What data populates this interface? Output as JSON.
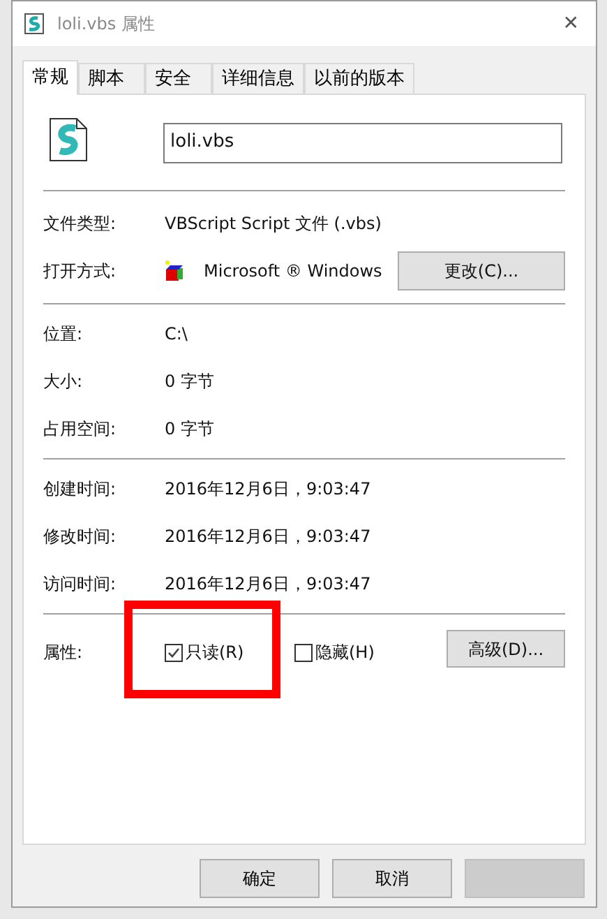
{
  "window": {
    "title": "loli.vbs 属性",
    "close": "✕"
  },
  "tabs": [
    {
      "label": "常规",
      "selected": true
    },
    {
      "label": "脚本",
      "selected": false
    },
    {
      "label": "安全",
      "selected": false
    },
    {
      "label": "详细信息",
      "selected": false
    },
    {
      "label": "以前的版本",
      "selected": false
    }
  ],
  "file_name": "loli.vbs",
  "type_info": [
    {
      "label": "文件类型:",
      "value": "VBScript Script 文件 (.vbs)"
    },
    {
      "label": "打开方式:",
      "value": "Microsoft ® Windows",
      "button": "更改(C)..."
    }
  ],
  "location_info": [
    {
      "label": "位置:",
      "value": "C:\\"
    },
    {
      "label": "大小:",
      "value": "0 字节"
    },
    {
      "label": "占用空间:",
      "value": "0 字节"
    }
  ],
  "time_info": [
    {
      "label": "创建时间:",
      "value": "2016年12月6日，9:03:47"
    },
    {
      "label": "修改时间:",
      "value": "2016年12月6日，9:03:47"
    },
    {
      "label": "访问时间:",
      "value": "2016年12月6日，9:03:47"
    }
  ],
  "attributes": {
    "label": "属性:",
    "checkboxes": [
      {
        "label": "只读(R)",
        "checked": true,
        "highlighted": true
      },
      {
        "label": "隐藏(H)",
        "checked": false,
        "highlighted": false
      }
    ],
    "button": "高级(D)..."
  },
  "buttons": [
    {
      "label": "确定",
      "disabled": false
    },
    {
      "label": "取消",
      "disabled": false
    },
    {
      "disabled": true
    }
  ]
}
